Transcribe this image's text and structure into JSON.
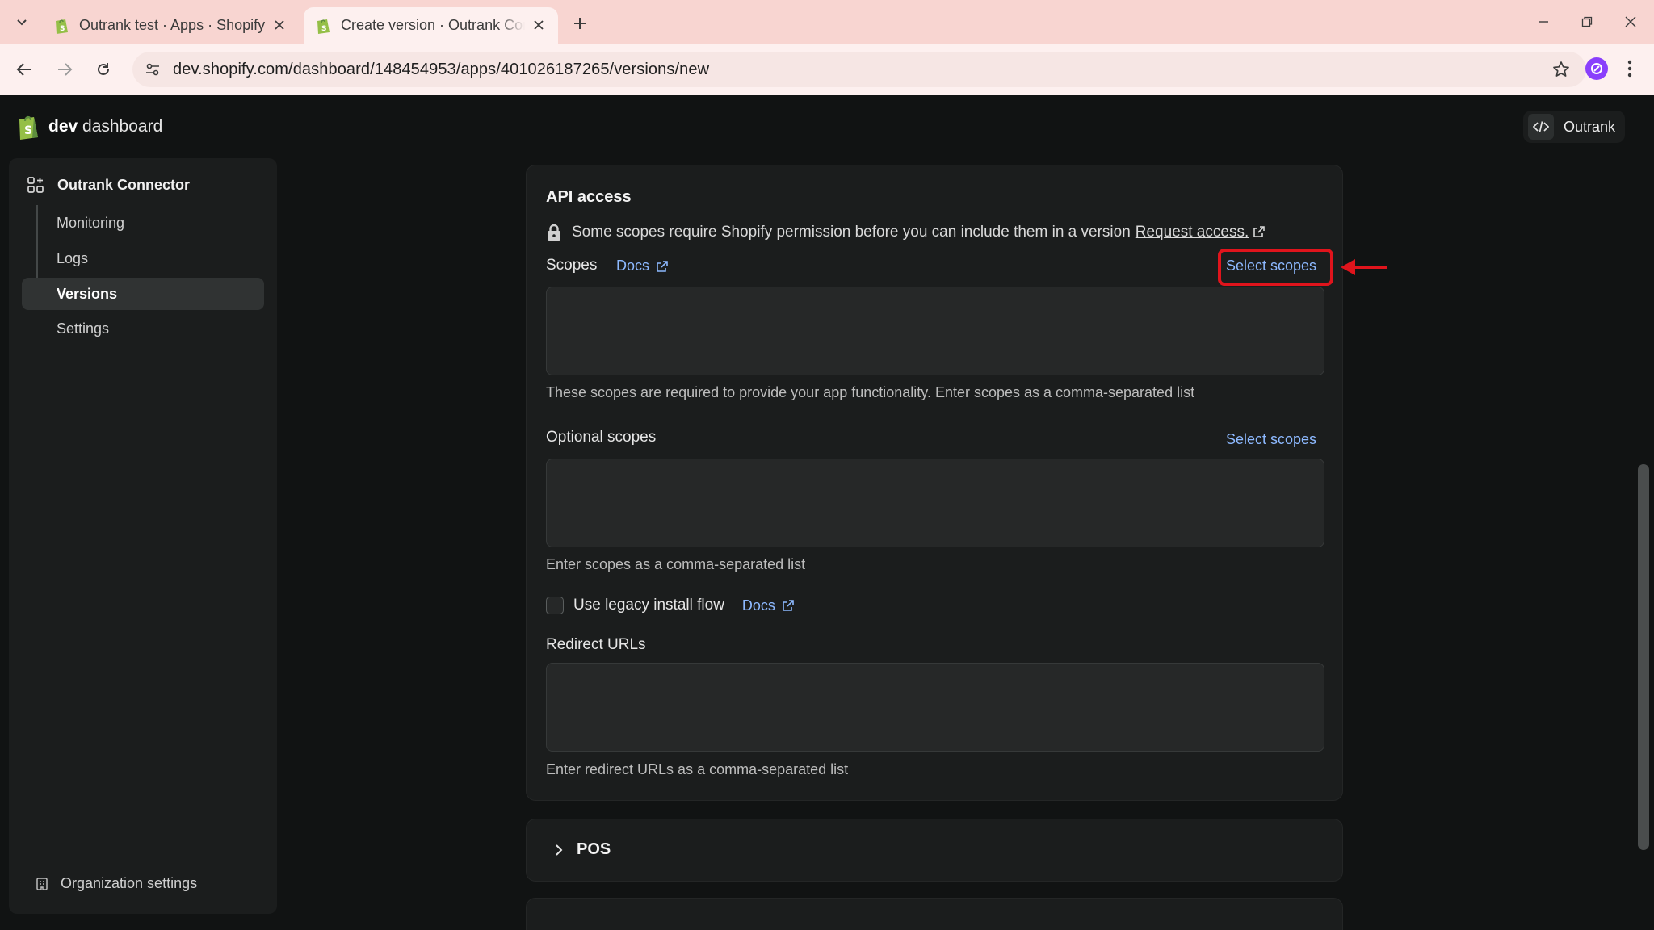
{
  "browser": {
    "tabs": [
      {
        "title": "Outrank test · Apps · Shopify",
        "active": false
      },
      {
        "title": "Create version · Outrank Connector",
        "active": true
      }
    ],
    "url": "dev.shopify.com/dashboard/148454953/apps/401026187265/versions/new",
    "icons": [
      "tab-search-icon",
      "close-icon",
      "new-tab-icon",
      "minimize-icon",
      "restore-icon",
      "back-icon",
      "forward-icon",
      "reload-icon",
      "site-info-icon",
      "star-icon",
      "profile-icon",
      "menu-icon"
    ]
  },
  "header": {
    "brand_bold": "dev",
    "brand_rest": " dashboard",
    "org_label": "Outrank"
  },
  "sidebar": {
    "app_name": "Outrank Connector",
    "items": [
      {
        "label": "Monitoring",
        "active": false
      },
      {
        "label": "Logs",
        "active": false
      },
      {
        "label": "Versions",
        "active": true
      },
      {
        "label": "Settings",
        "active": false
      }
    ],
    "footer_label": "Organization settings"
  },
  "api_access": {
    "title": "API access",
    "notice_text": "Some scopes require Shopify permission before you can include them in a version",
    "notice_link": "Request access.",
    "scopes": {
      "label": "Scopes",
      "docs_label": "Docs",
      "select_label": "Select scopes",
      "value": "",
      "help": "These scopes are required to provide your app functionality. Enter scopes as a comma-separated list"
    },
    "optional_scopes": {
      "label": "Optional scopes",
      "select_label": "Select scopes",
      "value": "",
      "help": "Enter scopes as a comma-separated list"
    },
    "legacy_install": {
      "label": "Use legacy install flow",
      "docs_label": "Docs",
      "checked": false
    },
    "redirect_urls": {
      "label": "Redirect URLs",
      "value": "",
      "help": "Enter redirect URLs as a comma-separated list"
    }
  },
  "pos": {
    "label": "POS"
  },
  "colors": {
    "page_bg": "#111313",
    "card_bg": "#1b1d1d",
    "link": "#8db9ff",
    "highlight": "#e0141c",
    "tabbar_bg": "#f8d5d1"
  }
}
